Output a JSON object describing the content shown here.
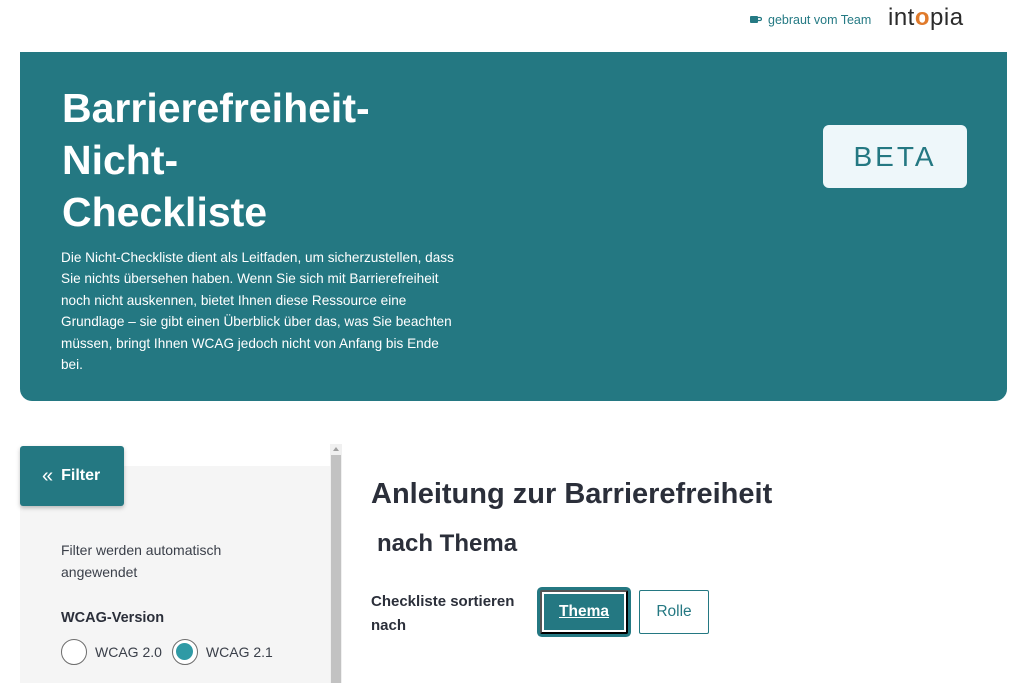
{
  "header": {
    "brewed_label": "gebraut vom Team",
    "logo_text_pre": "int",
    "logo_text_o": "o",
    "logo_text_post": "pia",
    "icon": "coffee-cup-icon"
  },
  "hero": {
    "title_line1": "Barrierefreiheit-",
    "title_line2": "Nicht-",
    "title_line3": "Checkliste",
    "description": "Die Nicht-Checkliste dient als Leitfaden, um sicherzustellen, dass Sie nichts übersehen haben. Wenn Sie sich mit Barrierefreiheit noch nicht auskennen, bietet Ihnen diese Ressource eine Grundlage – sie gibt einen Überblick über das, was Sie beachten müssen, bringt Ihnen WCAG jedoch nicht von Anfang bis Ende bei.",
    "badge": "BETA",
    "background_color": "#247882"
  },
  "sidebar": {
    "filter_button": "Filter",
    "filter_icon": "double-chevron-left-icon",
    "note": "Filter werden automatisch angewendet",
    "wcag_heading": "WCAG-Version",
    "options": [
      {
        "label": "WCAG 2.0",
        "checked": false
      },
      {
        "label": "WCAG 2.1",
        "checked": true
      }
    ]
  },
  "main": {
    "title": "Anleitung zur Barrierefreiheit",
    "subtitle": "nach Thema",
    "sort_label": "Checkliste sortieren nach",
    "sort_options": [
      {
        "label": "Thema",
        "active": true
      },
      {
        "label": "Rolle",
        "active": false
      }
    ]
  }
}
